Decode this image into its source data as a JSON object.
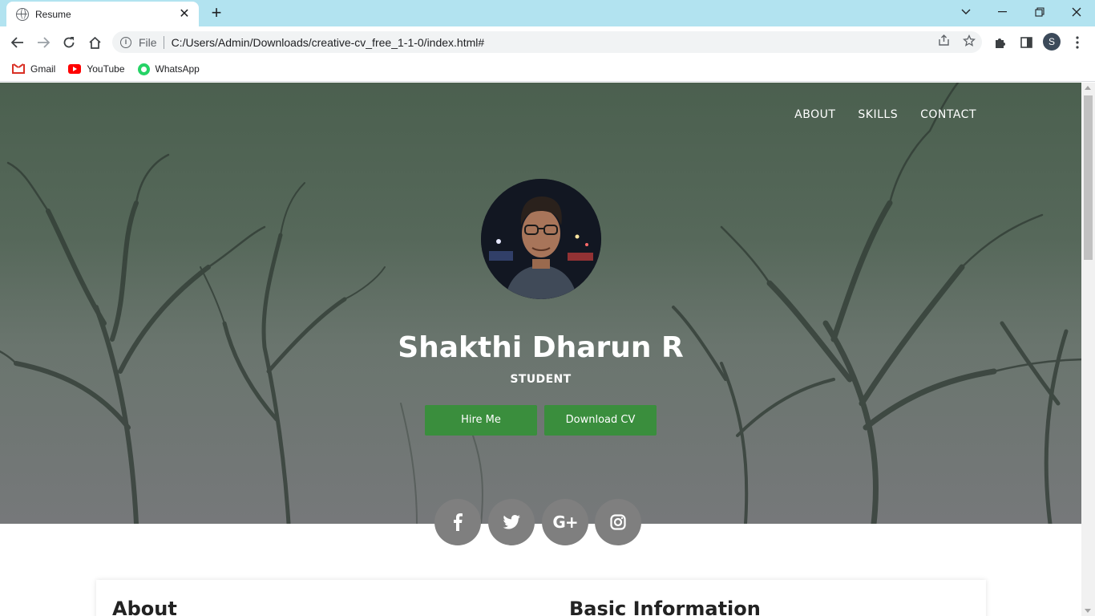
{
  "browser": {
    "tab_title": "Resume",
    "tab_close": "✕",
    "new_tab": "+",
    "address_scheme": "File",
    "address_url": "C:/Users/Admin/Downloads/creative-cv_free_1-1-0/index.html#",
    "profile_initial": "S",
    "bookmarks": [
      {
        "label": "Gmail",
        "icon": "gmail-icon"
      },
      {
        "label": "YouTube",
        "icon": "youtube-icon"
      },
      {
        "label": "WhatsApp",
        "icon": "whatsapp-icon"
      }
    ]
  },
  "page": {
    "nav": [
      "ABOUT",
      "SKILLS",
      "CONTACT"
    ],
    "name": "Shakthi Dharun R",
    "role": "STUDENT",
    "buttons": {
      "hire": "Hire Me",
      "download": "Download CV"
    },
    "social": [
      "facebook-icon",
      "twitter-icon",
      "google-plus-icon",
      "instagram-icon"
    ],
    "sections": {
      "about": "About",
      "basic_info": "Basic Information"
    },
    "colors": {
      "button": "#3a8e3d",
      "social_circle": "#7f7f7f",
      "tab_strip": "#b2e3f0"
    }
  }
}
